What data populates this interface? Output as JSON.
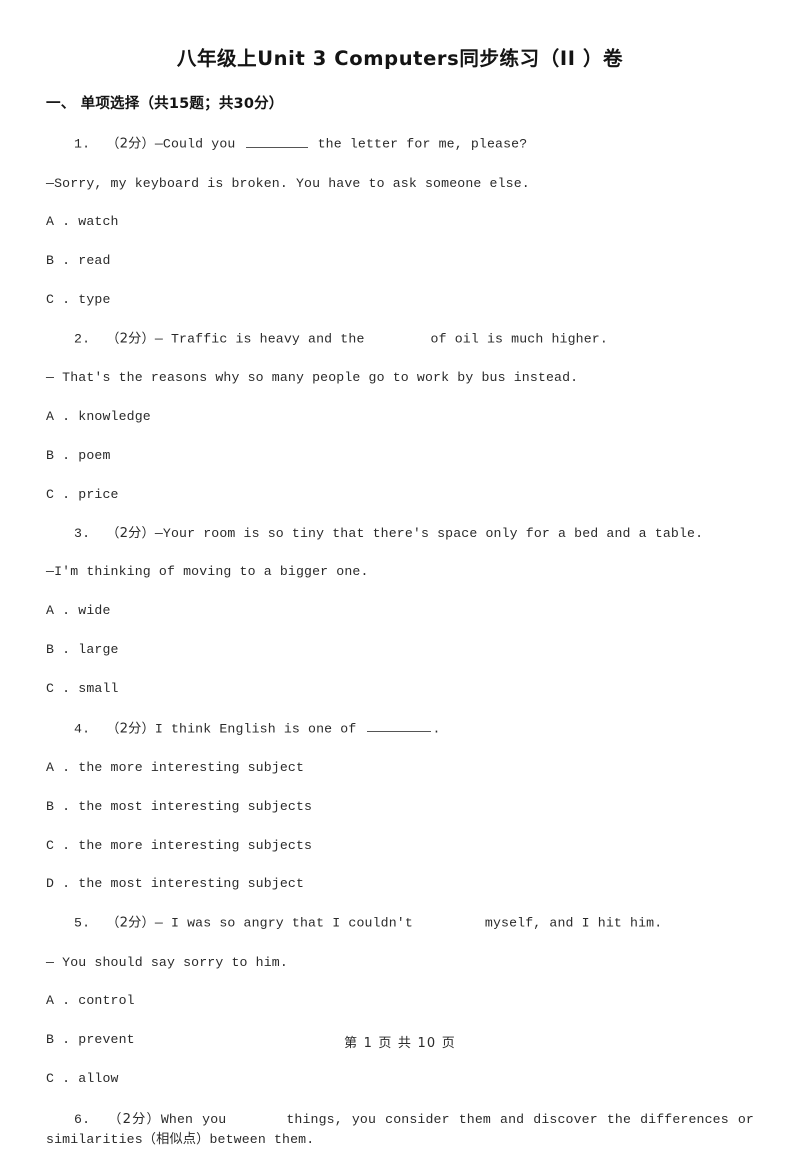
{
  "document": {
    "title": "八年级上Unit 3 Computers同步练习（II ）卷",
    "section_heading": "一、 单项选择（共15题；共30分）",
    "footer": "第 1 页 共 10 页"
  },
  "questions": [
    {
      "number": "1.",
      "score": "（2分）",
      "stem_before": "—Could you ",
      "stem_after": " the letter for me, please?",
      "second_line": "—Sorry, my keyboard is broken. You have to ask someone else.",
      "options": [
        "A . watch",
        "B . read",
        "C . type"
      ]
    },
    {
      "number": "2.",
      "score": "（2分）",
      "stem_before": "— Traffic is heavy and the",
      "stem_after": "of oil is much higher.",
      "second_line": "— That's the reasons why so many people go to work by bus instead.",
      "options": [
        "A . knowledge",
        "B . poem",
        "C . price"
      ]
    },
    {
      "number": "3.",
      "score": "（2分）",
      "stem_before": "—Your room is so tiny that there's space only for a bed and a table.",
      "stem_after": "",
      "second_line": "—I'm thinking of moving to a bigger one.",
      "options": [
        "A . wide",
        "B . large",
        "C . small"
      ]
    },
    {
      "number": "4.",
      "score": "（2分）",
      "stem_before": "I think English is one of ",
      "stem_after": ".",
      "second_line": "",
      "options": [
        "A . the more interesting subject",
        "B . the most interesting subjects",
        "C . the more interesting subjects",
        "D . the most interesting subject"
      ]
    },
    {
      "number": "5.",
      "score": "（2分）",
      "stem_before": "— I was so angry that I couldn't",
      "stem_after": "myself, and I hit him.",
      "second_line": "— You should say sorry to him.",
      "options": [
        "A . control",
        "B . prevent",
        "C . allow"
      ]
    },
    {
      "number": "6.",
      "score": "（2分）",
      "stem_before": "When you",
      "stem_after": "things, you consider them and discover the differences or similarities（相似点）between them.",
      "second_line": "",
      "options": []
    }
  ]
}
